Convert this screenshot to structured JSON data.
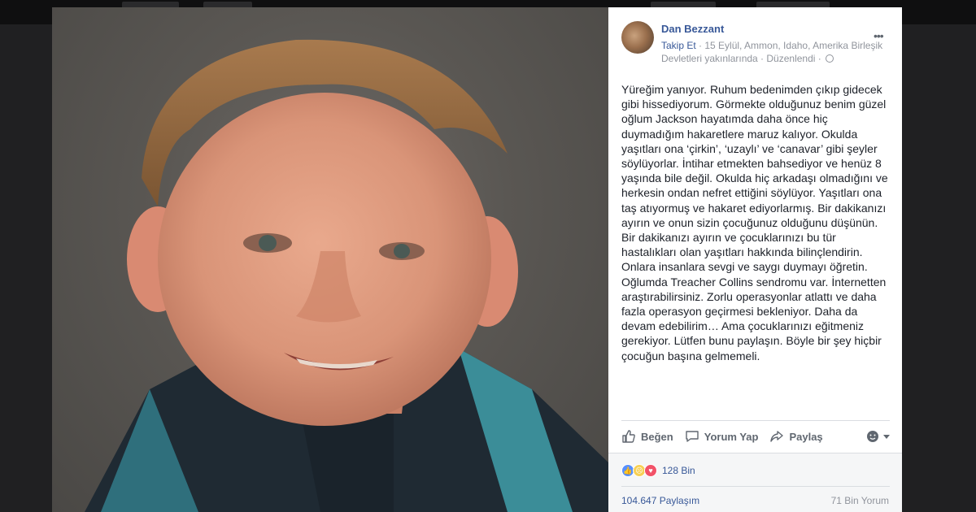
{
  "post": {
    "author": "Dan Bezzant",
    "follow_label": "Takip Et",
    "meta_line": " · 15 Eylül, Ammon, Idaho, Amerika Birleşik Devletleri yakınlarında · Düzenlendi · ",
    "more_icon": "more-dots-icon",
    "body": "Yüreğim yanıyor. Ruhum bedenimden çıkıp gidecek gibi hissediyorum. Görmekte olduğunuz benim güzel oğlum Jackson hayatımda daha önce hiç duymadığım hakaretlere maruz kalıyor. Okulda yaşıtları ona ‘çirkin’, ‘uzaylı’ ve ‘canavar’ gibi şeyler söylüyorlar. İntihar etmekten bahsediyor ve henüz 8 yaşında bile değil. Okulda hiç arkadaşı olmadığını ve herkesin ondan nefret ettiğini söylüyor. Yaşıtları ona taş atıyormuş ve hakaret ediyorlarmış. Bir dakikanızı ayırın ve onun sizin çocuğunuz olduğunu düşünün. Bir dakikanızı ayırın ve çocuklarınızı bu tür hastalıkları olan yaşıtları hakkında bilinçlendirin. Onlara insanlara sevgi ve saygı duymayı öğretin. Oğlumda Treacher Collins sendromu var. İnternetten araştırabilirsiniz. Zorlu operasyonlar atlattı ve daha fazla operasyon geçirmesi bekleniyor. Daha da devam edebilirim… Ama çocuklarınızı eğitmeniz gerekiyor. Lütfen bunu paylaşın. Böyle bir şey hiçbir çocuğun başına gelmemeli."
  },
  "actions": {
    "like": "Beğen",
    "comment": "Yorum Yap",
    "share": "Paylaş",
    "audience_icon": "emoji-picker-icon"
  },
  "stats": {
    "reaction_count": "128 Bin",
    "shares": "104.647 Paylaşım",
    "comments": "71 Bin Yorum",
    "reaction_icons": [
      "like-icon",
      "sad-icon",
      "love-icon"
    ]
  },
  "colors": {
    "link": "#385898",
    "muted": "#90949c",
    "text": "#1d2129",
    "like": "#5890ff",
    "sad": "#f7d055",
    "love": "#f25268"
  }
}
